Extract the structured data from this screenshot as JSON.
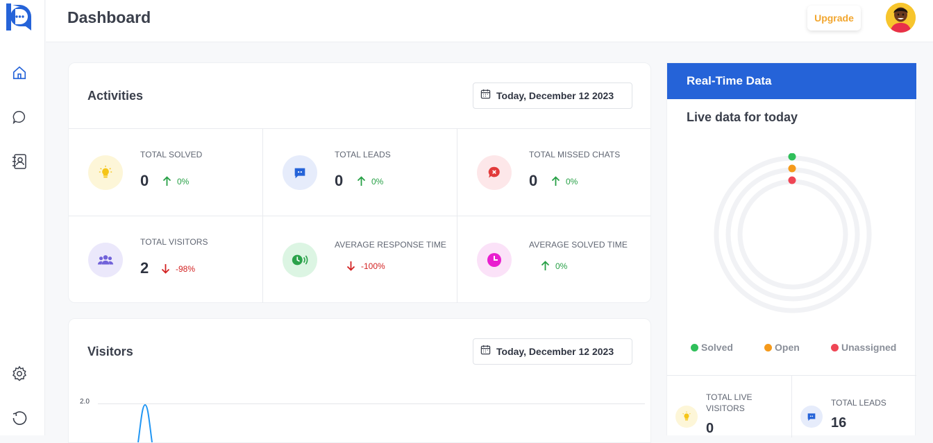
{
  "header": {
    "title": "Dashboard",
    "upgrade_label": "Upgrade"
  },
  "sidebar": {
    "items": [
      {
        "name": "home-icon"
      },
      {
        "name": "chat-icon"
      },
      {
        "name": "contacts-icon"
      },
      {
        "name": "settings-icon"
      },
      {
        "name": "logout-icon"
      }
    ]
  },
  "activities": {
    "title": "Activities",
    "date": "Today, December 12 2023",
    "stats": [
      {
        "label": "TOTAL SOLVED",
        "value": "0",
        "trend": "0%",
        "direction": "up",
        "icon": "lightbulb-icon",
        "color": "#f5c518"
      },
      {
        "label": "TOTAL LEADS",
        "value": "0",
        "trend": "0%",
        "direction": "up",
        "icon": "chat-bubble-icon",
        "color": "#2563d8"
      },
      {
        "label": "TOTAL MISSED CHATS",
        "value": "0",
        "trend": "0%",
        "direction": "up",
        "icon": "missed-chat-icon",
        "color": "#e23b3b"
      },
      {
        "label": "TOTAL VISITORS",
        "value": "2",
        "trend": "-98%",
        "direction": "down",
        "icon": "visitors-icon",
        "color": "#7162d9"
      },
      {
        "label": "AVERAGE RESPONSE TIME",
        "value": "",
        "trend": "-100%",
        "direction": "down",
        "icon": "response-time-icon",
        "color": "#2aa24a"
      },
      {
        "label": "AVERAGE SOLVED TIME",
        "value": "",
        "trend": "0%",
        "direction": "up",
        "icon": "clock-icon",
        "color": "#e91ecf"
      }
    ]
  },
  "visitors": {
    "title": "Visitors",
    "date": "Today, December 12 2023",
    "y_tick": "2.0"
  },
  "realtime": {
    "header": "Real-Time Data",
    "subtitle": "Live data for today",
    "legend": [
      {
        "label": "Solved",
        "color": "#2fbf5a"
      },
      {
        "label": "Open",
        "color": "#f59a1b"
      },
      {
        "label": "Unassigned",
        "color": "#ef4655"
      }
    ],
    "mini_stats": [
      {
        "label_line1": "TOTAL LIVE",
        "label_line2": "VISITORS",
        "value": "0"
      },
      {
        "label_line1": "TOTAL LEADS",
        "label_line2": "",
        "value": "16"
      }
    ]
  },
  "colors": {
    "accent": "#2563d8",
    "upgrade": "#f2a62e"
  }
}
